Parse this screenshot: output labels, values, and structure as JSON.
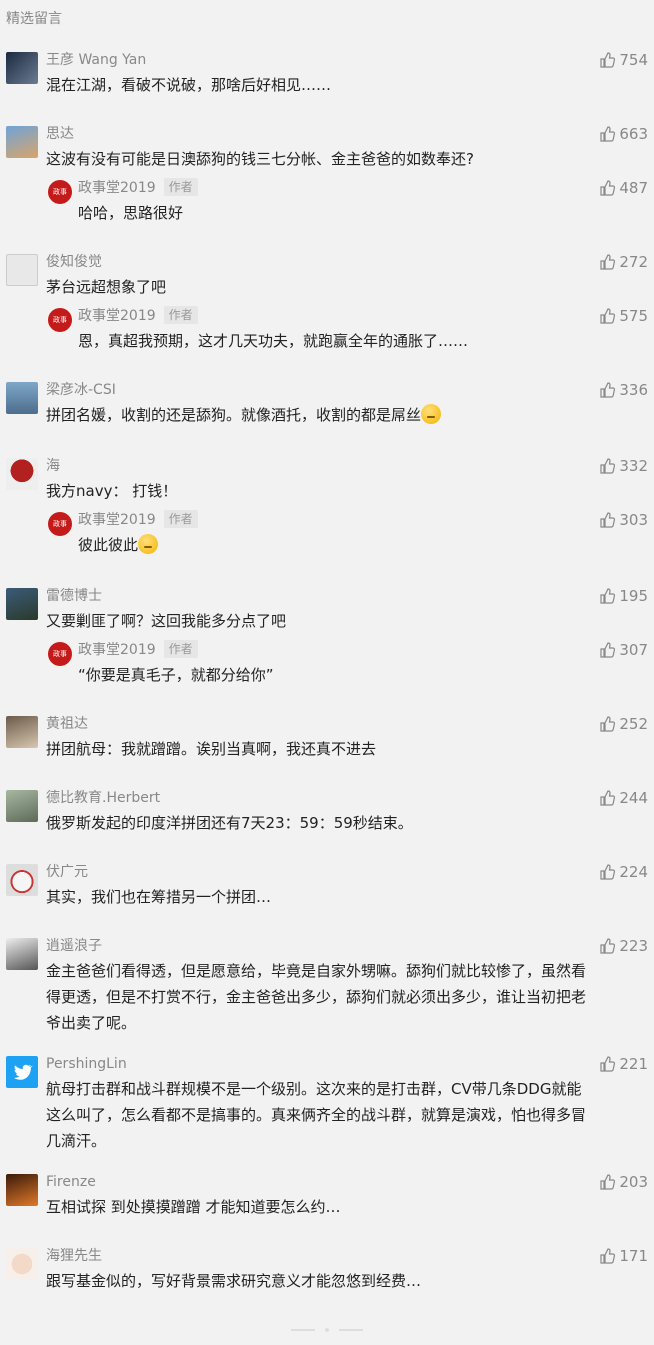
{
  "section_title": "精选留言",
  "author_tag": "作者",
  "comments": [
    {
      "name": "王彦 Wang Yan",
      "text": "混在江湖，看破不说破，那啥后好相见……",
      "likes": "754"
    },
    {
      "name": "思达",
      "text": "这波有没有可能是日澳舔狗的钱三七分帐、金主爸爸的如数奉还?",
      "likes": "663",
      "reply": {
        "name": "政事堂2019",
        "text": "哈哈，思路很好",
        "likes": "487"
      }
    },
    {
      "name": "俊知俊觉",
      "text": "茅台远超想象了吧",
      "likes": "272",
      "reply": {
        "name": "政事堂2019",
        "text": "恩，真超我预期，这才几天功夫，就跑赢全年的通胀了……",
        "likes": "575"
      }
    },
    {
      "name": "梁彦冰-CSI",
      "text": "拼团名媛，收割的还是舔狗。就像酒托，收割的都是屌丝",
      "likes": "336"
    },
    {
      "name": "海",
      "text": "我方navy： 打钱！",
      "likes": "332",
      "reply": {
        "name": "政事堂2019",
        "text": "彼此彼此",
        "likes": "303"
      }
    },
    {
      "name": "雷德博士",
      "text": "又要剿匪了啊？这回我能多分点了吧",
      "likes": "195",
      "reply": {
        "name": "政事堂2019",
        "text": "“你要是真毛子，就都分给你”",
        "likes": "307"
      }
    },
    {
      "name": "黄祖达",
      "text": "拼团航母：我就蹭蹭。诶别当真啊，我还真不进去",
      "likes": "252"
    },
    {
      "name": "德比教育.Herbert",
      "text": "俄罗斯发起的印度洋拼团还有7天23：59：59秒结束。",
      "likes": "244"
    },
    {
      "name": "伏广元",
      "text": "其实，我们也在筹措另一个拼团…",
      "likes": "224"
    },
    {
      "name": "逍遥浪子",
      "text_lines": [
        "金主爸爸们看得透，但是愿意给，毕竟是自家外甥嘛。舔狗们就比较惨了，虽然看",
        "得更透，但是不打赏不行，金主爸爸出多少，舔狗们就必须出多少，谁让当初把老",
        "爷出卖了呢。"
      ],
      "likes": "223"
    },
    {
      "name": "PershingLin",
      "text_lines": [
        "航母打击群和战斗群规模不是一个级别。这次来的是打击群，CV带几条DDG就能",
        "这么叫了，怎么看都不是搞事的。真来俩齐全的战斗群，就算是演戏，怕也得多冒",
        "几滴汗。"
      ],
      "likes": "221"
    },
    {
      "name": "Firenze",
      "text": "互相试探 到处摸摸蹭蹭 才能知道要怎么约…",
      "likes": "203"
    },
    {
      "name": "海狸先生",
      "text": "跟写基金似的，写好背景需求研究意义才能忽悠到经费…",
      "likes": "171"
    }
  ],
  "colors": {
    "background": "#f2f2f2",
    "name": "#888888",
    "text": "#222222",
    "author_avatar": "#c41a1a"
  }
}
